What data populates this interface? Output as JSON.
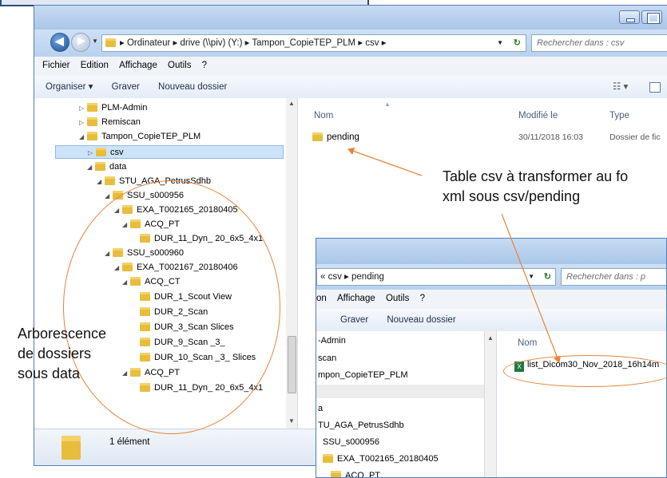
{
  "explorer_main": {
    "address_path": "▸ Ordinateur ▸ drive (\\\\piv) (Y:) ▸ Tampon_CopieTEP_PLM ▸ csv ▸",
    "search_placeholder": "Rechercher dans : csv",
    "menu": [
      "Fichier",
      "Edition",
      "Affichage",
      "Outils",
      "?"
    ],
    "toolbar": {
      "organize": "Organiser ▾",
      "burn": "Graver",
      "new_folder": "Nouveau dossier"
    },
    "tree": [
      "PLM-Admin",
      "Remiscan",
      "Tampon_CopieTEP_PLM",
      "csv",
      "data",
      "STU_AGA_PetrusSdhb",
      "SSU_s000956",
      "EXA_T002165_20180405",
      "ACQ_PT",
      "DUR_11_Dyn_ 20_6x5_4x1",
      "SSU_s000960",
      "EXA_T002167_20180406",
      "ACQ_CT",
      "DUR_1_Scout View",
      "DUR_2_Scan",
      "DUR_3_Scan Slices",
      "DUR_9_Scan _3_",
      "DUR_10_Scan _3_ Slices",
      "ACQ_PT",
      "DUR_11_Dyn_ 20_6x5_4x1"
    ],
    "columns": {
      "name": "Nom",
      "modified": "Modifié le",
      "type": "Type"
    },
    "file": {
      "name": "pending",
      "modified": "30/11/2018 16:03",
      "type": "Dossier de fic"
    },
    "status": "1 élément"
  },
  "explorer_second": {
    "address_path": "« csv ▸ pending",
    "search_placeholder": "Rechercher dans : p",
    "menu": [
      "on",
      "Affichage",
      "Outils",
      "?"
    ],
    "toolbar": {
      "burn": "Graver",
      "new_folder": "Nouveau dossier"
    },
    "tree": [
      "-Admin",
      "scan",
      "mpon_CopieTEP_PLM",
      "",
      "a",
      "TU_AGA_PetrusSdhb",
      "SSU_s000956",
      "EXA_T002165_20180405",
      "ACQ_PT"
    ],
    "column_name": "Nom",
    "file": "list_Dicom30_Nov_2018_16h14m"
  },
  "annotations": {
    "table_csv": [
      "Table csv à transformer au fo",
      "xml sous csv/pending"
    ],
    "tree": [
      "Arborescence",
      "de dossiers",
      "sous data"
    ]
  },
  "colors": {
    "accent": "#e8833a",
    "folder": "#e8bd3c",
    "chrome": "#bcd3ee"
  }
}
